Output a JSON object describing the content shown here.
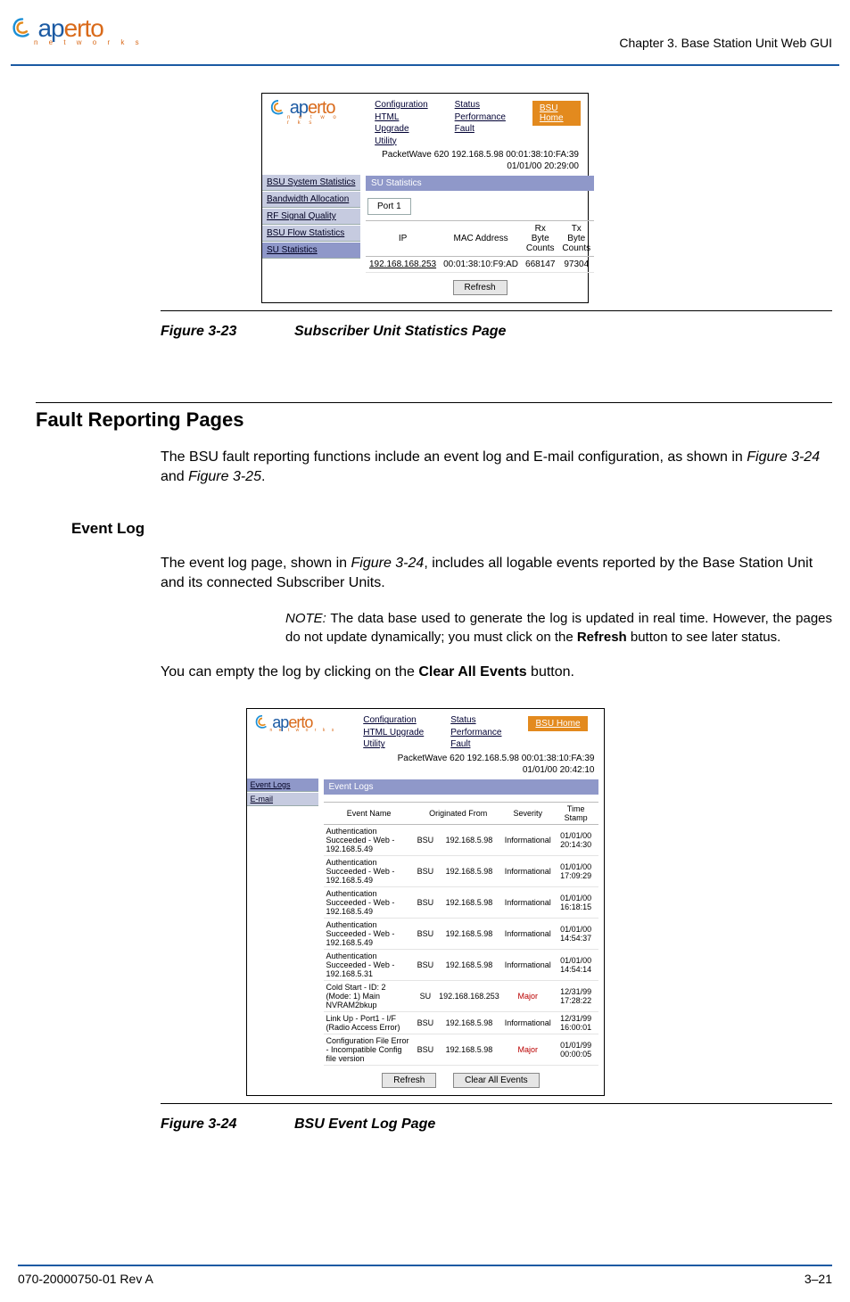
{
  "header": {
    "chapter": "Chapter 3.  Base Station Unit Web GUI",
    "logo": {
      "brand_a": "ap",
      "brand_b": "erto",
      "sub": "n e t w o r k s"
    }
  },
  "footer": {
    "doc_id": "070-20000750-01 Rev A",
    "page_num": "3–21"
  },
  "fig23": {
    "num": "Figure 3-23",
    "title": "Subscriber Unit Statistics Page"
  },
  "fig24": {
    "num": "Figure 3-24",
    "title": "BSU Event Log Page"
  },
  "sec_fault_h2": "Fault Reporting Pages",
  "sec_fault_p1a": "The BSU fault reporting functions include an event log and E-mail configuration, as shown in ",
  "sec_fault_p1b": "Figure 3-24",
  "sec_fault_p1c": " and ",
  "sec_fault_p1d": "Figure 3-25",
  "sec_fault_p1e": ".",
  "sec_evt_h3": "Event Log",
  "sec_evt_p1a": "The event log page, shown in ",
  "sec_evt_p1b": "Figure 3-24",
  "sec_evt_p1c": ", includes all logable events reported by the Base Station Unit and its connected Subscriber Units.",
  "note_lbl": "NOTE:",
  "note_txt1": "  The data base used to generate the log is updated in real time. However, the pages do not update dynamically; you must click on the ",
  "note_bold": "Refresh",
  "note_txt2": " button to see later status.",
  "sec_evt_p2a": "You can empty the log by clicking on the ",
  "sec_evt_p2b": "Clear All Events",
  "sec_evt_p2c": " button.",
  "shotA": {
    "links_col1": [
      "Configuration",
      "HTML Upgrade",
      "Utility"
    ],
    "links_col2": [
      "Status",
      "Performance",
      "Fault"
    ],
    "bsu_home": "BSU Home",
    "pw_line1": "PacketWave 620    192.168.5.98    00:01:38:10:FA:39",
    "pw_line2": "01/01/00    20:29:00",
    "sidebar": [
      "BSU System Statistics",
      "Bandwidth Allocation",
      "RF Signal Quality",
      "BSU Flow Statistics",
      "SU Statistics"
    ],
    "panel_title": "SU Statistics",
    "port_tab": "Port 1",
    "cols": [
      "IP",
      "MAC Address",
      "Rx Byte Counts",
      "Tx Byte Counts"
    ],
    "row": [
      "192.168.168.253",
      "00:01:38:10:F9:AD",
      "668147",
      "97304"
    ],
    "refresh": "Refresh"
  },
  "shotB": {
    "links_col1": [
      "Configuration",
      "HTML Upgrade",
      "Utility"
    ],
    "links_col2": [
      "Status",
      "Performance",
      "Fault"
    ],
    "bsu_home": "BSU Home",
    "pw_line1": "PacketWave 620    192.168.5.98    00:01:38:10:FA:39",
    "pw_line2": "01/01/00    20:42:10",
    "sidebar": [
      "Event Logs",
      "E-mail"
    ],
    "panel_title": "Event Logs",
    "cols": [
      "Event Name",
      "Originated From",
      "",
      "Severity",
      "Time Stamp"
    ],
    "rows": [
      [
        "Authentication Succeeded - Web - 192.168.5.49",
        "BSU",
        "192.168.5.98",
        "Informational",
        "01/01/00 20:14:30"
      ],
      [
        "Authentication Succeeded - Web - 192.168.5.49",
        "BSU",
        "192.168.5.98",
        "Informational",
        "01/01/00 17:09:29"
      ],
      [
        "Authentication Succeeded - Web - 192.168.5.49",
        "BSU",
        "192.168.5.98",
        "Informational",
        "01/01/00 16:18:15"
      ],
      [
        "Authentication Succeeded - Web - 192.168.5.49",
        "BSU",
        "192.168.5.98",
        "Informational",
        "01/01/00 14:54:37"
      ],
      [
        "Authentication Succeeded - Web - 192.168.5.31",
        "BSU",
        "192.168.5.98",
        "Informational",
        "01/01/00 14:54:14"
      ],
      [
        "Cold Start - ID: 2 (Mode: 1) Main NVRAM2bkup",
        "SU",
        "192.168.168.253",
        "Major",
        "12/31/99 17:28:22"
      ],
      [
        "Link Up - Port1 - I/F (Radio Access Error)",
        "BSU",
        "192.168.5.98",
        "Informational",
        "12/31/99 16:00:01"
      ],
      [
        "Configuration File Error - Incompatible Config file version",
        "BSU",
        "192.168.5.98",
        "Major",
        "01/01/99 00:00:05"
      ]
    ],
    "refresh": "Refresh",
    "clear": "Clear All Events"
  }
}
